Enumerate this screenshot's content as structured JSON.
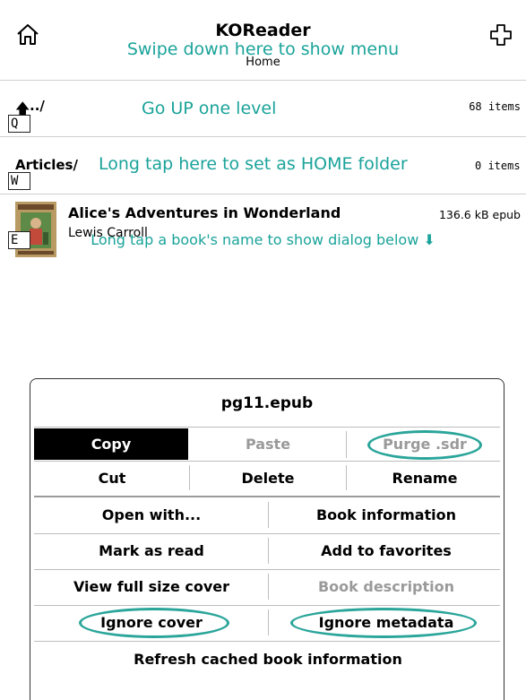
{
  "header": {
    "title": "KOReader",
    "path": "Home",
    "hint": "Swipe down here to show menu"
  },
  "icons": {
    "home": "home-icon",
    "plus": "plus-icon",
    "up_arrow": "up-arrow-icon",
    "down_arrow": "down-arrow-icon"
  },
  "rows": [
    {
      "key": "Q",
      "arrow": "🡅",
      "name": "../",
      "right": "68 items",
      "hint": "Go UP one level"
    },
    {
      "key": "W",
      "name": "Articles/",
      "right": "0 items",
      "hint": "Long tap here to set as HOME folder"
    },
    {
      "key": "E",
      "title": "Alice's Adventures in Wonderland",
      "author": "Lewis Carroll",
      "right": "136.6 kB epub"
    }
  ],
  "dialog_hint": "Long tap a book's name to show dialog below ⬇",
  "dialog": {
    "title": "pg11.epub",
    "row1": [
      "Copy",
      "Paste",
      "Purge .sdr"
    ],
    "row2": [
      "Cut",
      "Delete",
      "Rename"
    ],
    "row3": [
      "Open with...",
      "Book information"
    ],
    "row4": [
      "Mark as read",
      "Add to favorites"
    ],
    "row5": [
      "View full size cover",
      "Book description"
    ],
    "row6": [
      "Ignore cover",
      "Ignore metadata"
    ],
    "row7": [
      "Refresh cached book information"
    ]
  },
  "colors": {
    "hint": "#1aa39a",
    "ring": "#2aa59a",
    "disabled": "#9a9a9a"
  }
}
